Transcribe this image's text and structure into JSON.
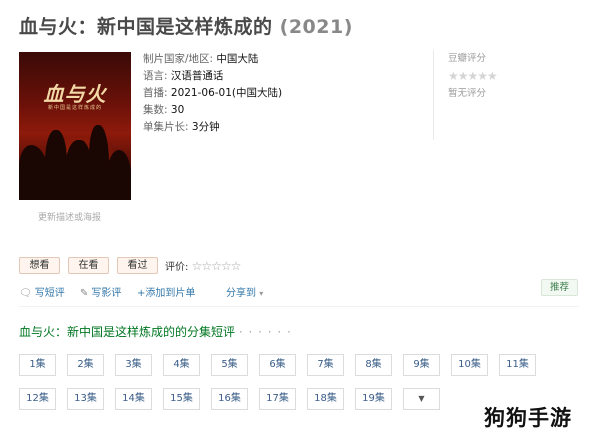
{
  "title": {
    "main": "血与火：新中国是这样炼成的",
    "year": "(2021)"
  },
  "poster": {
    "title": "血与火",
    "subtitle": "新中国是这样炼成的",
    "caption": "更新描述或海报"
  },
  "info": {
    "country_label": "制片国家/地区:",
    "country": "中国大陆",
    "language_label": "语言:",
    "language": "汉语普通话",
    "premiere_label": "首播:",
    "premiere": "2021-06-01(中国大陆)",
    "episodes_label": "集数:",
    "episodes": "30",
    "runtime_label": "单集片长:",
    "runtime": "3分钟"
  },
  "rating": {
    "label": "豆瓣评分",
    "stars": "★★★★★",
    "none": "暂无评分"
  },
  "buttons": {
    "want": "想看",
    "watching": "在看",
    "watched": "看过"
  },
  "rate": {
    "label": "评价:",
    "stars": "☆☆☆☆☆"
  },
  "actions": {
    "short_review": "写短评",
    "review": "写影评",
    "add_list": "+添加到片单",
    "share": "分享到",
    "recommend": "推荐"
  },
  "section": {
    "title": "血与火：新中国是这样炼成的的分集短评",
    "dots": "· · · · · ·"
  },
  "episodes_row1": [
    "1集",
    "2集",
    "3集",
    "4集",
    "5集",
    "6集",
    "7集",
    "8集",
    "9集",
    "10集",
    "11集"
  ],
  "episodes_row2": [
    "12集",
    "13集",
    "14集",
    "15集",
    "16集",
    "17集",
    "18集",
    "19集"
  ],
  "more": "▼",
  "watermark": "狗狗手游"
}
